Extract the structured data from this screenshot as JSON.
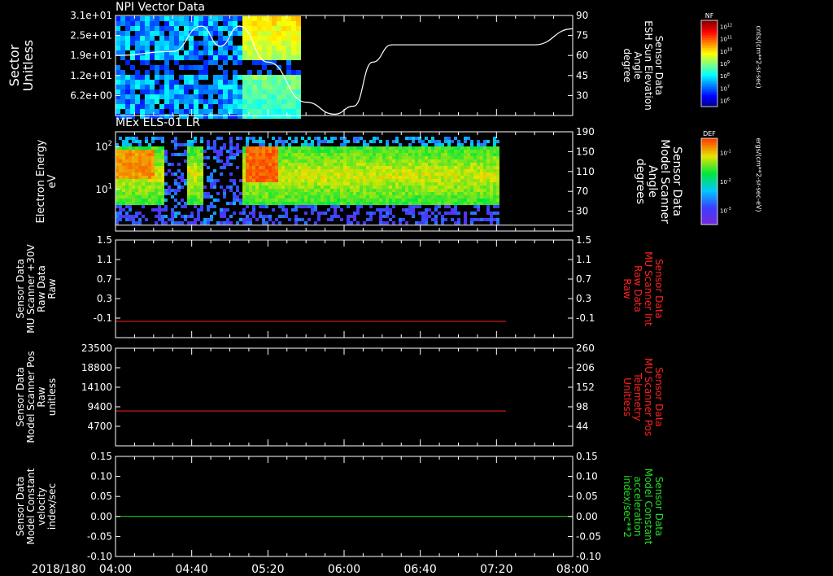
{
  "panels": [
    {
      "title": "NPI Vector Data",
      "left_label": [
        "Sector",
        "Unitless"
      ],
      "right_label": [
        "Sensor Data",
        "ESH Sun Elevation",
        "Angle",
        "degree"
      ],
      "left_ticks": [
        "3.1e+01",
        "2.5e+01",
        "1.9e+01",
        "1.2e+01",
        "6.2e+00"
      ],
      "right_ticks": [
        "90",
        "75",
        "60",
        "45",
        "30"
      ],
      "colorbar": {
        "label": "NF",
        "unit": "cnts/(cm**2-sr-sec)",
        "ticks": [
          "10^12",
          "10^11",
          "10^10",
          "10^9",
          "10^8",
          "10^7",
          "10^6"
        ]
      }
    },
    {
      "title": "MEx ELS-01 LR",
      "left_label": [
        "Electron Energy",
        "eV"
      ],
      "right_label": [
        "Sensor Data",
        "Model Scanner",
        "Angle",
        "degrees"
      ],
      "left_ticks": [
        "10^2",
        "10^1"
      ],
      "right_ticks": [
        "190",
        "150",
        "110",
        "70",
        "30"
      ],
      "colorbar": {
        "label": "DEF",
        "unit": "ergs/(cm**2-sr-sec-eV)",
        "ticks": [
          "10^-1",
          "10^-2",
          "10^-3"
        ]
      }
    },
    {
      "left_label": [
        "Sensor Data",
        "MU Scanner +30V",
        "Raw Data",
        "Raw"
      ],
      "right_label": [
        "Sensor Data",
        "MU Scanner Int",
        "Raw Data",
        "Raw"
      ],
      "left_ticks": [
        "1.5",
        "1.1",
        "0.7",
        "0.3",
        "-0.1"
      ],
      "right_ticks": [
        "1.5",
        "1.1",
        "0.7",
        "0.3",
        "-0.1"
      ]
    },
    {
      "left_label": [
        "Sensor Data",
        "Model Scanner Pos",
        "Raw",
        "unitless"
      ],
      "right_label": [
        "Sensor Data",
        "MU Scanner Pos",
        "Telemetry",
        "Unitless"
      ],
      "left_ticks": [
        "23500",
        "18800",
        "14100",
        "9400",
        "4700"
      ],
      "right_ticks": [
        "260",
        "206",
        "152",
        "98",
        "44"
      ]
    },
    {
      "left_label": [
        "Sensor Data",
        "Model Constant",
        "velocity",
        "index/sec"
      ],
      "right_label": [
        "Sensor Data",
        "Model Constant",
        "acceleration",
        "index/sec**2"
      ],
      "left_ticks": [
        "0.15",
        "0.10",
        "0.05",
        "0.00",
        "-0.05",
        "-0.10"
      ],
      "right_ticks": [
        "0.15",
        "0.10",
        "0.05",
        "0.00",
        "-0.05",
        "-0.10"
      ]
    }
  ],
  "x_axis": {
    "date": "2018/180",
    "ticks": [
      "04:00",
      "04:40",
      "05:20",
      "06:00",
      "06:40",
      "07:20",
      "08:00"
    ]
  },
  "colors": {
    "background": "#000000",
    "axes": "#ffffff",
    "red_trace": "#ff2020",
    "green_trace": "#20e020",
    "red_label": "#ff2020",
    "green_label": "#20e020"
  },
  "chart_data": [
    {
      "type": "heatmap",
      "title": "NPI Vector Data",
      "x_range": [
        "04:00",
        "08:00"
      ],
      "data_extent_end": "05:35",
      "y_label": "Sector Unitless",
      "ylim": [
        0,
        31
      ],
      "overlay_line": {
        "name": "ESH Sun Elevation Angle",
        "axis": "right",
        "ylim": [
          15,
          90
        ],
        "x": [
          "04:00",
          "04:30",
          "04:45",
          "04:55",
          "05:05",
          "05:20",
          "05:40",
          "05:55",
          "06:05",
          "06:15",
          "06:25",
          "07:00",
          "07:40",
          "08:00"
        ],
        "y": [
          60,
          63,
          82,
          67,
          82,
          55,
          25,
          16,
          22,
          55,
          68,
          68,
          68,
          80
        ]
      }
    },
    {
      "type": "heatmap",
      "title": "MEx ELS-01 LR",
      "x_range": [
        "04:00",
        "08:00"
      ],
      "data_extent_end": "07:20",
      "y_label": "Electron Energy eV",
      "yscale": "log",
      "ylim": [
        1,
        150
      ],
      "overlay_line": {
        "name": "Model Scanner Angle",
        "axis": "right",
        "ylim": [
          0,
          190
        ],
        "x": [
          "04:00",
          "07:20",
          "08:00"
        ],
        "y": [
          5,
          5,
          5
        ]
      }
    },
    {
      "type": "line",
      "x": [
        "04:00",
        "07:25"
      ],
      "ylim": [
        -0.3,
        1.5
      ],
      "series": [
        {
          "values": [
            0,
            0
          ]
        }
      ]
    },
    {
      "type": "line",
      "x": [
        "04:00",
        "07:25"
      ],
      "ylim": [
        0,
        23500
      ],
      "series": [
        {
          "values": [
            8400,
            8400
          ]
        }
      ]
    },
    {
      "type": "line",
      "x": [
        "04:00",
        "08:00"
      ],
      "ylim": [
        -0.1,
        0.15
      ],
      "series": [
        {
          "values": [
            0,
            0
          ]
        }
      ]
    }
  ]
}
